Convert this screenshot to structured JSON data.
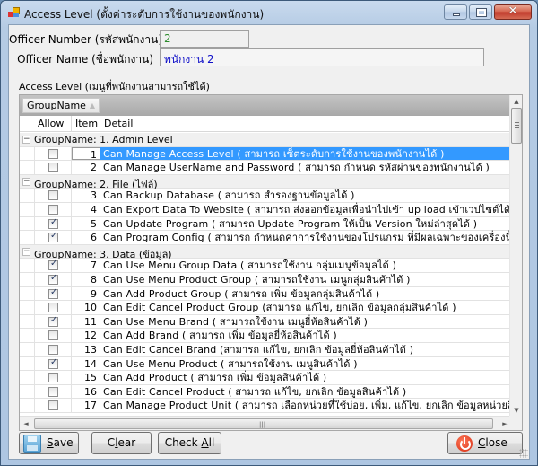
{
  "window": {
    "title": "Access Level (ตั้งค่าระดับการใช้งานของพนักงาน)",
    "caption_buttons": {
      "minimize": "minimize-icon",
      "maximize": "maximize-icon",
      "close": "✕"
    }
  },
  "form": {
    "officer_number_label": "Officer Number (รหัสพนักงาน)",
    "officer_number_value": "2",
    "officer_name_label": "Officer Name (ชื่อพนักงาน)",
    "officer_name_value": "พนักงาน 2",
    "section_label": "Access Level (เมนูที่พนักงานสามารถใช้ได้)"
  },
  "grid": {
    "group_by_chip": "GroupName",
    "columns": [
      "Allow",
      "Item",
      "Detail"
    ],
    "groups": [
      {
        "label": "GroupName:  1. Admin Level",
        "toggle": "−",
        "rows": [
          {
            "allow": false,
            "item": "1",
            "detail": "Can Manage Access Level ( สามารถ เซ็ตระดับการใช้งานของพนักงานได้ )",
            "selected": true
          },
          {
            "allow": false,
            "item": "2",
            "detail": "Can Manage UserName and Password ( สามารถ กำหนด รหัสผ่านของพนักงานได้ )",
            "selected": false
          }
        ]
      },
      {
        "label": "GroupName:  2. File (ไฟล์)",
        "toggle": "−",
        "rows": [
          {
            "allow": false,
            "item": "3",
            "detail": "Can Backup Database ( สามารถ สำรองฐานข้อมูลได้ )",
            "selected": false
          },
          {
            "allow": false,
            "item": "4",
            "detail": "Can Export Data To Website ( สามารถ  ส่งออกข้อมูลเพื่อนำไปเข้า up load เข้าเวปไซต์ได้ )",
            "selected": false
          },
          {
            "allow": true,
            "item": "5",
            "detail": "Can Update Program ( สามารถ Update  Program ให้เป็น Version ใหม่ล่าสุดได้ )",
            "selected": false
          },
          {
            "allow": true,
            "item": "6",
            "detail": "Can Program Config ( สามารถ กำหนดค่าการใช้งานของโปรแกรม ที่มีผลเฉพาะของเครื่องนี้ ได้ )",
            "selected": false
          }
        ]
      },
      {
        "label": "GroupName:  3. Data (ข้อมูล)",
        "toggle": "−",
        "rows": [
          {
            "allow": true,
            "item": "7",
            "detail": "Can Use Menu Group Data ( สามารถใช้งาน กลุ่มเมนูข้อมูลได้ )",
            "selected": false
          },
          {
            "allow": true,
            "item": "8",
            "detail": "Can Use Menu Product Group ( สามารถใช้งาน เมนูกลุ่มสินค้าได้ )",
            "selected": false
          },
          {
            "allow": true,
            "item": "9",
            "detail": "Can Add Product Group ( สามารถ เพิ่ม ข้อมูลกลุ่มสินค้าได้ )",
            "selected": false
          },
          {
            "allow": false,
            "item": "10",
            "detail": "Can Edit Cancel Product Group (สามารถ แก้ไข, ยกเลิก ข้อมูลกลุ่มสินค้าได้ )",
            "selected": false
          },
          {
            "allow": true,
            "item": "11",
            "detail": "Can Use Menu Brand ( สามารถใช้งาน เมนูยี่ห้อสินค้าได้ )",
            "selected": false
          },
          {
            "allow": false,
            "item": "12",
            "detail": "Can Add Brand ( สามารถ เพิ่ม ข้อมูลยี่ห้อสินค้าได้ )",
            "selected": false
          },
          {
            "allow": false,
            "item": "13",
            "detail": "Can Edit Cancel Brand (สามารถ แก้ไข, ยกเลิก ข้อมูลยี่ห้อสินค้าได้ )",
            "selected": false
          },
          {
            "allow": true,
            "item": "14",
            "detail": "Can Use Menu Product ( สามารถใช้งาน เมนูสินค้าได้ )",
            "selected": false
          },
          {
            "allow": false,
            "item": "15",
            "detail": "Can Add Product ( สามารถ เพิ่ม ข้อมูลสินค้าได้ )",
            "selected": false
          },
          {
            "allow": false,
            "item": "16",
            "detail": "Can Edit Cancel Product ( สามารถ แก้ไข, ยกเลิก ข้อมูลสินค้าได้ )",
            "selected": false
          },
          {
            "allow": false,
            "item": "17",
            "detail": "Can Manage Product Unit ( สามารถ เลือกหน่วยที่ใช้บ่อย, เพิ่ม, แก้ไข, ยกเลิก  ข้อมูลหน่วยสินค้าได้ )",
            "selected": false
          }
        ]
      }
    ],
    "scroll_arrows": {
      "up": "▲",
      "down": "▼",
      "left": "◄",
      "right": "►",
      "grip": "|||"
    }
  },
  "buttons": {
    "save": {
      "mnemonic": "S",
      "rest": "ave"
    },
    "clear": {
      "pre": "C",
      "mnemonic": "l",
      "rest": "ear"
    },
    "check_all": {
      "pre": "Check ",
      "mnemonic": "A",
      "rest": "ll"
    },
    "close": {
      "mnemonic": "C",
      "rest": "lose"
    }
  }
}
